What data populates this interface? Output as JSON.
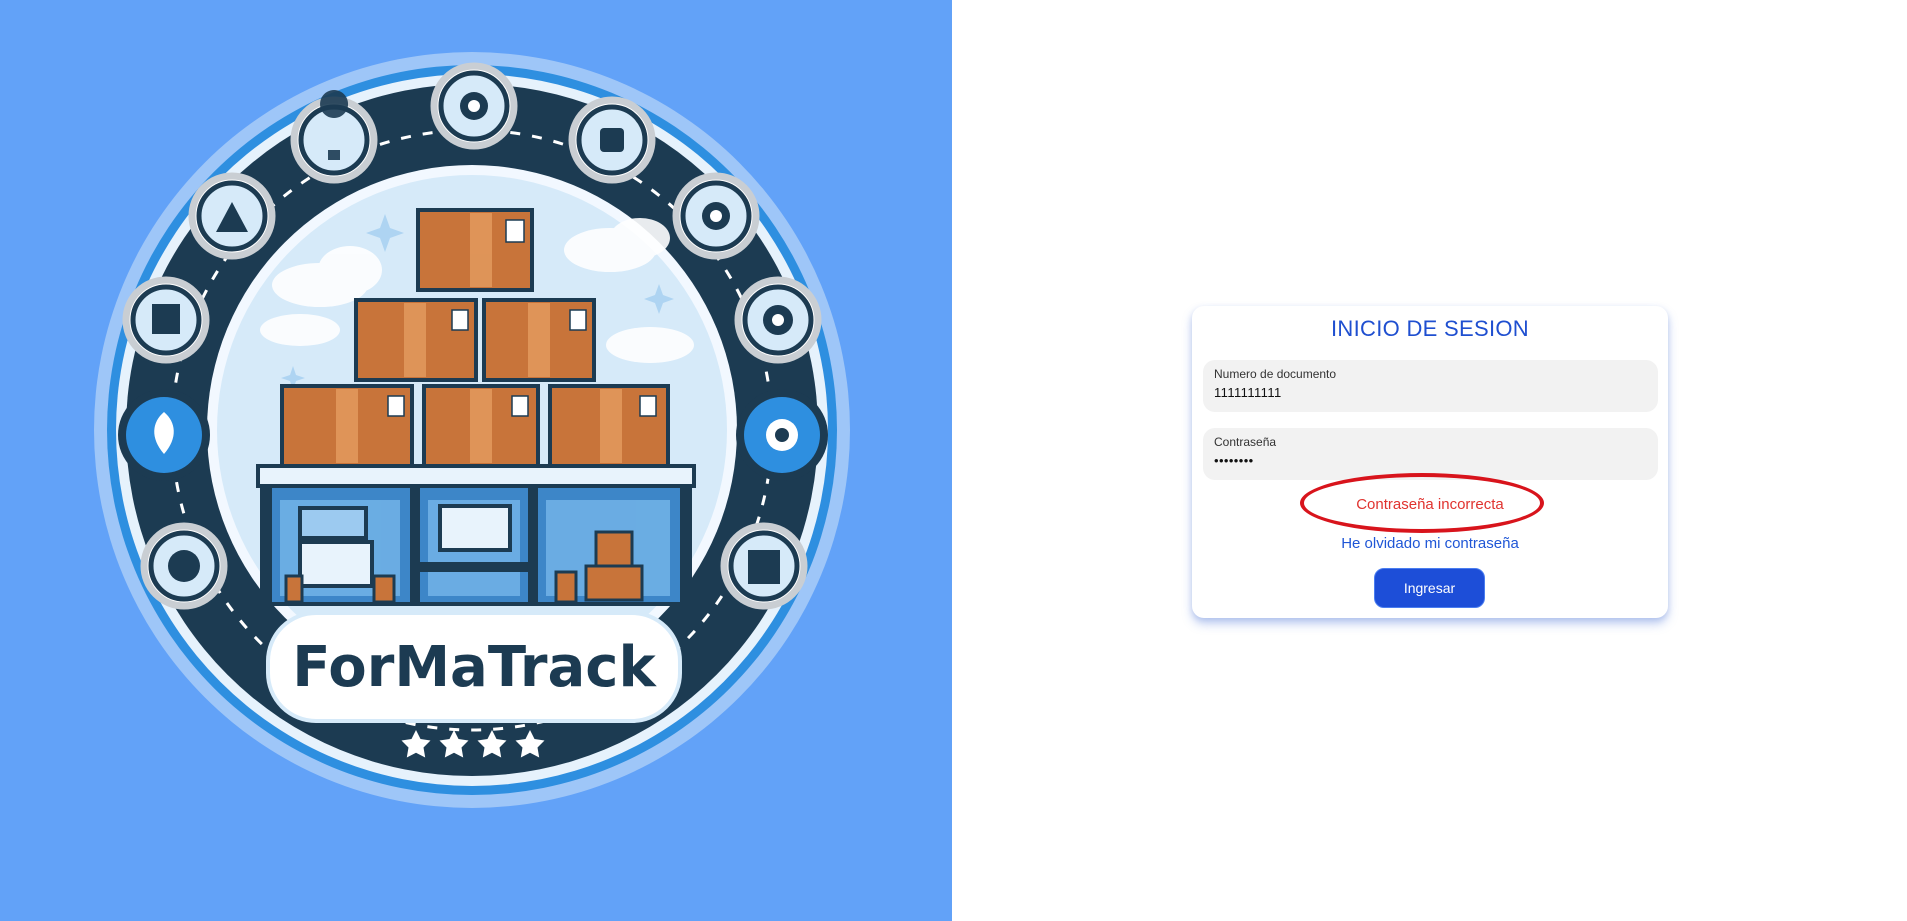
{
  "brand": {
    "name": "ForMaTrack",
    "stars": 4
  },
  "login": {
    "title": "INICIO DE SESION",
    "document_label": "Numero de documento",
    "document_value": "1111111111",
    "password_label": "Contraseña",
    "password_value": "••••••••",
    "error_message": "Contraseña incorrecta",
    "forgot_link": "He olvidado mi contraseña",
    "submit_label": "Ingresar"
  },
  "colors": {
    "left_background": "#62a2f8",
    "primary": "#1d4ed8",
    "error": "#e0332f",
    "highlight_oval": "#d8141c"
  },
  "logo_icons": [
    "lightbulb-icon",
    "gear-icon",
    "robot-arm-icon",
    "gear-icon",
    "network-icon",
    "gear-icon",
    "clipboard-icon",
    "gear-icon",
    "plant-icon",
    "gear-icon",
    "globe-icon",
    "grid-table-icon"
  ]
}
